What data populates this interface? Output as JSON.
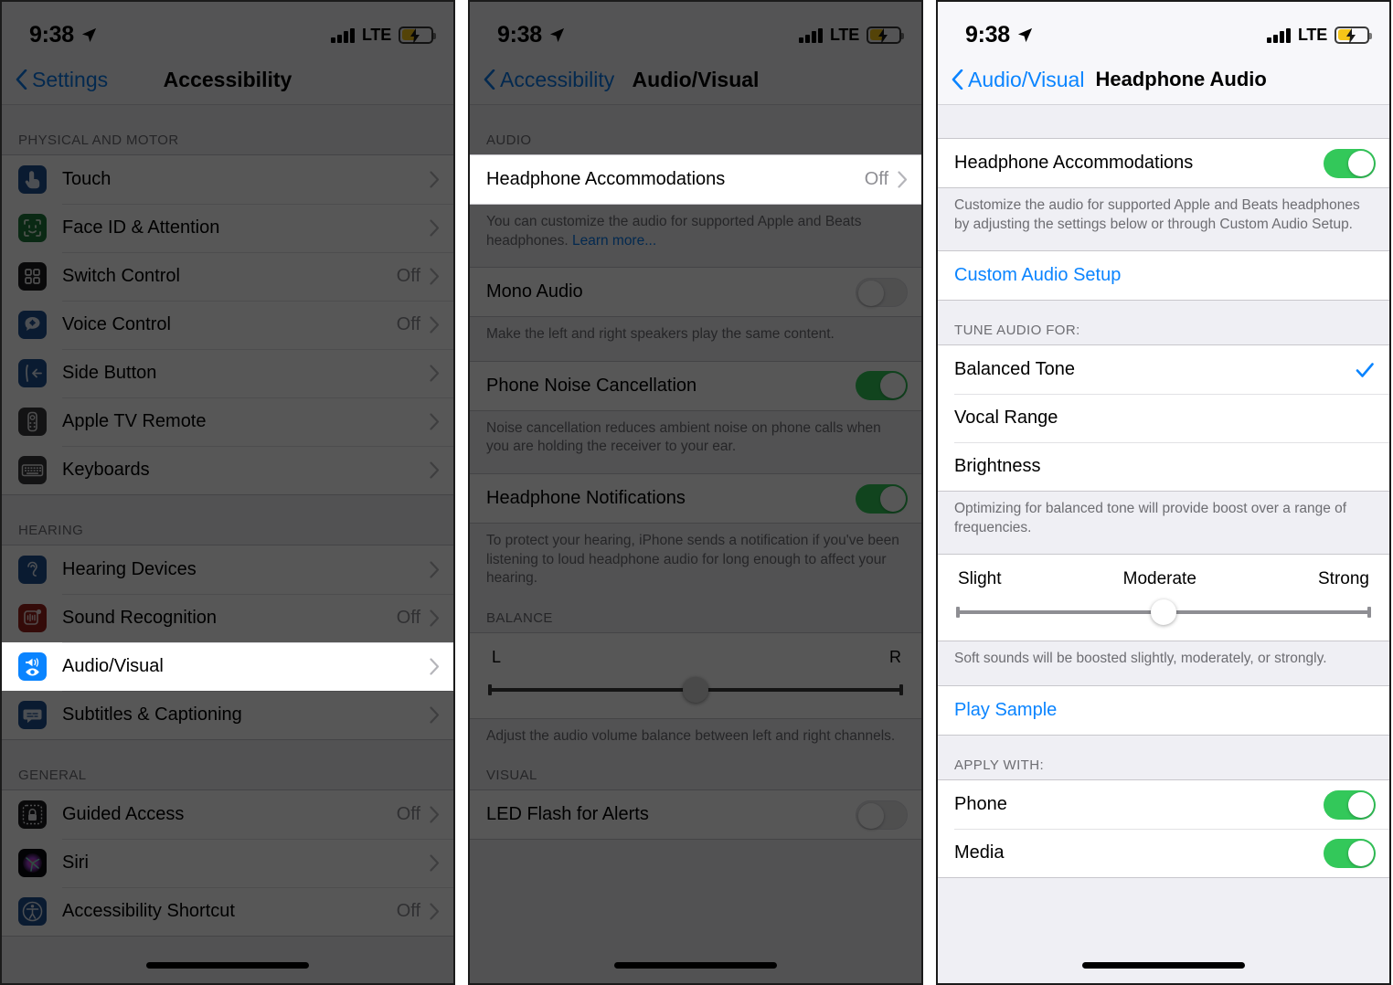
{
  "status_bar": {
    "time": "9:38",
    "location_icon": "location-arrow-icon",
    "signal_icon": "cellular-bars-icon",
    "carrier": "LTE",
    "battery_icon": "battery-charging-icon"
  },
  "panels": [
    {
      "id": "accessibility",
      "dimmed": true,
      "nav": {
        "back_label": "Settings",
        "title": "Accessibility"
      },
      "sections": [
        {
          "header": "PHYSICAL AND MOTOR",
          "rows": [
            {
              "icon": "touch-icon",
              "label": "Touch",
              "value": "",
              "accessory": "chevron"
            },
            {
              "icon": "face-id-icon",
              "label": "Face ID & Attention",
              "value": "",
              "accessory": "chevron"
            },
            {
              "icon": "switch-control-icon",
              "label": "Switch Control",
              "value": "Off",
              "accessory": "chevron"
            },
            {
              "icon": "voice-control-icon",
              "label": "Voice Control",
              "value": "Off",
              "accessory": "chevron"
            },
            {
              "icon": "side-button-icon",
              "label": "Side Button",
              "value": "",
              "accessory": "chevron"
            },
            {
              "icon": "apple-tv-remote-icon",
              "label": "Apple TV Remote",
              "value": "",
              "accessory": "chevron"
            },
            {
              "icon": "keyboards-icon",
              "label": "Keyboards",
              "value": "",
              "accessory": "chevron"
            }
          ]
        },
        {
          "header": "HEARING",
          "rows": [
            {
              "icon": "hearing-devices-icon",
              "label": "Hearing Devices",
              "value": "",
              "accessory": "chevron"
            },
            {
              "icon": "sound-recognition-icon",
              "label": "Sound Recognition",
              "value": "Off",
              "accessory": "chevron"
            },
            {
              "icon": "audio-visual-icon",
              "label": "Audio/Visual",
              "value": "",
              "accessory": "chevron",
              "highlighted": true
            },
            {
              "icon": "subtitles-captioning-icon",
              "label": "Subtitles & Captioning",
              "value": "",
              "accessory": "chevron"
            }
          ]
        },
        {
          "header": "GENERAL",
          "rows": [
            {
              "icon": "guided-access-icon",
              "label": "Guided Access",
              "value": "Off",
              "accessory": "chevron"
            },
            {
              "icon": "siri-icon",
              "label": "Siri",
              "value": "",
              "accessory": "chevron"
            },
            {
              "icon": "accessibility-shortcut-icon",
              "label": "Accessibility Shortcut",
              "value": "Off",
              "accessory": "chevron"
            }
          ]
        }
      ]
    },
    {
      "id": "audio-visual",
      "dimmed": true,
      "nav": {
        "back_label": "Accessibility",
        "title": "Audio/Visual"
      },
      "audio_header": "AUDIO",
      "headphone_accommodations": {
        "label": "Headphone Accommodations",
        "value": "Off",
        "highlighted": true
      },
      "headphone_accommodations_footnote": "You can customize the audio for supported Apple and Beats headphones. ",
      "learn_more": "Learn more...",
      "mono_audio": {
        "label": "Mono Audio",
        "state": "off"
      },
      "mono_audio_footnote": "Make the left and right speakers play the same content.",
      "phone_noise_cancellation": {
        "label": "Phone Noise Cancellation",
        "state": "on"
      },
      "phone_noise_cancellation_footnote": "Noise cancellation reduces ambient noise on phone calls when you are holding the receiver to your ear.",
      "headphone_notifications": {
        "label": "Headphone Notifications",
        "state": "on"
      },
      "headphone_notifications_footnote": "To protect your hearing, iPhone sends a notification if you've been listening to loud headphone audio for long enough to affect your hearing.",
      "balance_header": "BALANCE",
      "balance_left": "L",
      "balance_right": "R",
      "balance_position_pct": 50,
      "balance_footnote": "Adjust the audio volume balance between left and right channels.",
      "visual_header": "VISUAL",
      "led_flash": {
        "label": "LED Flash for Alerts",
        "state": "off"
      }
    },
    {
      "id": "headphone-audio",
      "dimmed": false,
      "nav": {
        "back_label": "Audio/Visual",
        "title": "Headphone Audio"
      },
      "headphone_accommodations": {
        "label": "Headphone Accommodations",
        "state": "on"
      },
      "headphone_accommodations_footnote": "Customize the audio for supported Apple and Beats headphones by adjusting the settings below or through Custom Audio Setup.",
      "custom_audio_setup": "Custom Audio Setup",
      "tune_audio_header": "TUNE AUDIO FOR:",
      "tune_options": [
        {
          "label": "Balanced Tone",
          "selected": true
        },
        {
          "label": "Vocal Range",
          "selected": false
        },
        {
          "label": "Brightness",
          "selected": false
        }
      ],
      "tune_footnote": "Optimizing for balanced tone will provide boost over a range of frequencies.",
      "strength_labels": [
        "Slight",
        "Moderate",
        "Strong"
      ],
      "strength_position_pct": 50,
      "strength_footnote": "Soft sounds will be boosted slightly, moderately, or strongly.",
      "play_sample": "Play Sample",
      "apply_with_header": "APPLY WITH:",
      "apply_rows": [
        {
          "label": "Phone",
          "state": "on"
        },
        {
          "label": "Media",
          "state": "on"
        }
      ]
    }
  ],
  "colors": {
    "ios_blue": "#0a78e8",
    "link_blue": "#0a84ff",
    "toggle_green": "#33c85a",
    "group_bg": "#efeff4",
    "secondary_text": "#6d6d72",
    "battery_yellow": "#f5c518"
  }
}
